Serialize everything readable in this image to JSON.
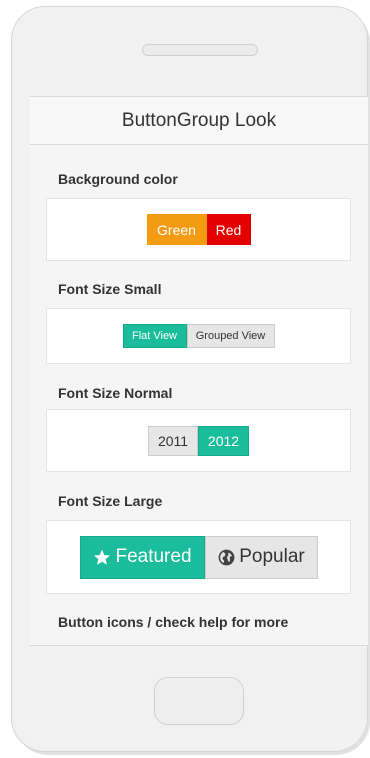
{
  "header": {
    "title": "ButtonGroup Look"
  },
  "sections": {
    "background_color": {
      "label": "Background color",
      "buttons": [
        {
          "label": "Green",
          "color": "#f39c12"
        },
        {
          "label": "Red",
          "color": "#e50000"
        }
      ]
    },
    "font_small": {
      "label": "Font Size Small",
      "buttons": [
        {
          "label": "Flat View",
          "active": true
        },
        {
          "label": "Grouped View",
          "active": false
        }
      ]
    },
    "font_normal": {
      "label": "Font Size Normal",
      "buttons": [
        {
          "label": "2011",
          "active": false
        },
        {
          "label": "2012",
          "active": true
        }
      ]
    },
    "font_large": {
      "label": "Font Size Large",
      "buttons": [
        {
          "label": "Featured",
          "icon": "star-icon",
          "active": true
        },
        {
          "label": "Popular",
          "icon": "globe-icon",
          "active": false
        }
      ]
    },
    "button_icons": {
      "label": "Button icons / check help for more"
    }
  },
  "colors": {
    "accent": "#1abc9c",
    "inactive": "#e6e6e6"
  }
}
